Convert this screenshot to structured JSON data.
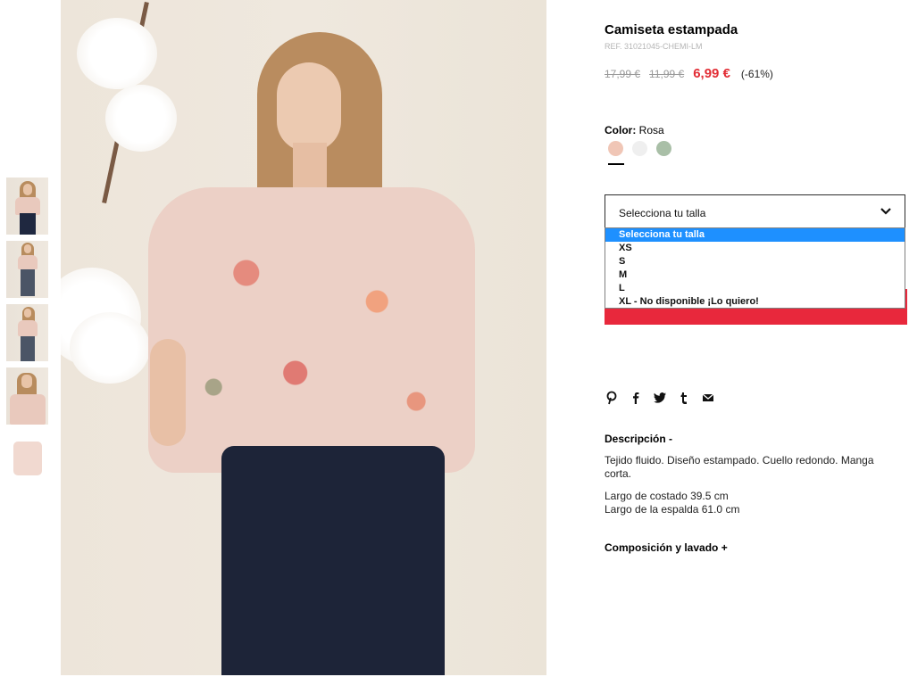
{
  "gallery": {
    "thumbnails": [
      {
        "name": "front-view"
      },
      {
        "name": "full-body-view"
      },
      {
        "name": "side-view"
      },
      {
        "name": "detail-view"
      },
      {
        "name": "flat-product-view"
      }
    ]
  },
  "product": {
    "title": "Camiseta estampada",
    "ref": "REF. 31021045-CHEMI-LM",
    "price_original": "17,99 €",
    "price_previous": "11,99 €",
    "price_current": "6,99 €",
    "discount": "(-61%)"
  },
  "color": {
    "label": "Color:",
    "value": "Rosa",
    "swatches": [
      "#f0c6b6",
      "#efefef",
      "#a9bfa7"
    ]
  },
  "size": {
    "select_label": "Selecciona tu talla",
    "options": [
      "Selecciona tu talla",
      "XS",
      "S",
      "M",
      "L",
      "XL - No disponible ¡Lo quiero!"
    ],
    "selected_index": 0
  },
  "share": {
    "icons": [
      "pinterest-icon",
      "facebook-icon",
      "twitter-icon",
      "tumblr-icon",
      "email-icon"
    ]
  },
  "description": {
    "title": "Descripción -",
    "text": "Tejido fluido. Diseño estampado. Cuello redondo. Manga corta.",
    "measure_1": "Largo de costado 39.5 cm",
    "measure_2": "Largo de la espalda 61.0 cm"
  },
  "composition": {
    "title": "Composición y lavado +"
  },
  "colors": {
    "accent_red": "#e8283c",
    "price_red": "#e22d35",
    "select_highlight": "#1e90ff"
  }
}
